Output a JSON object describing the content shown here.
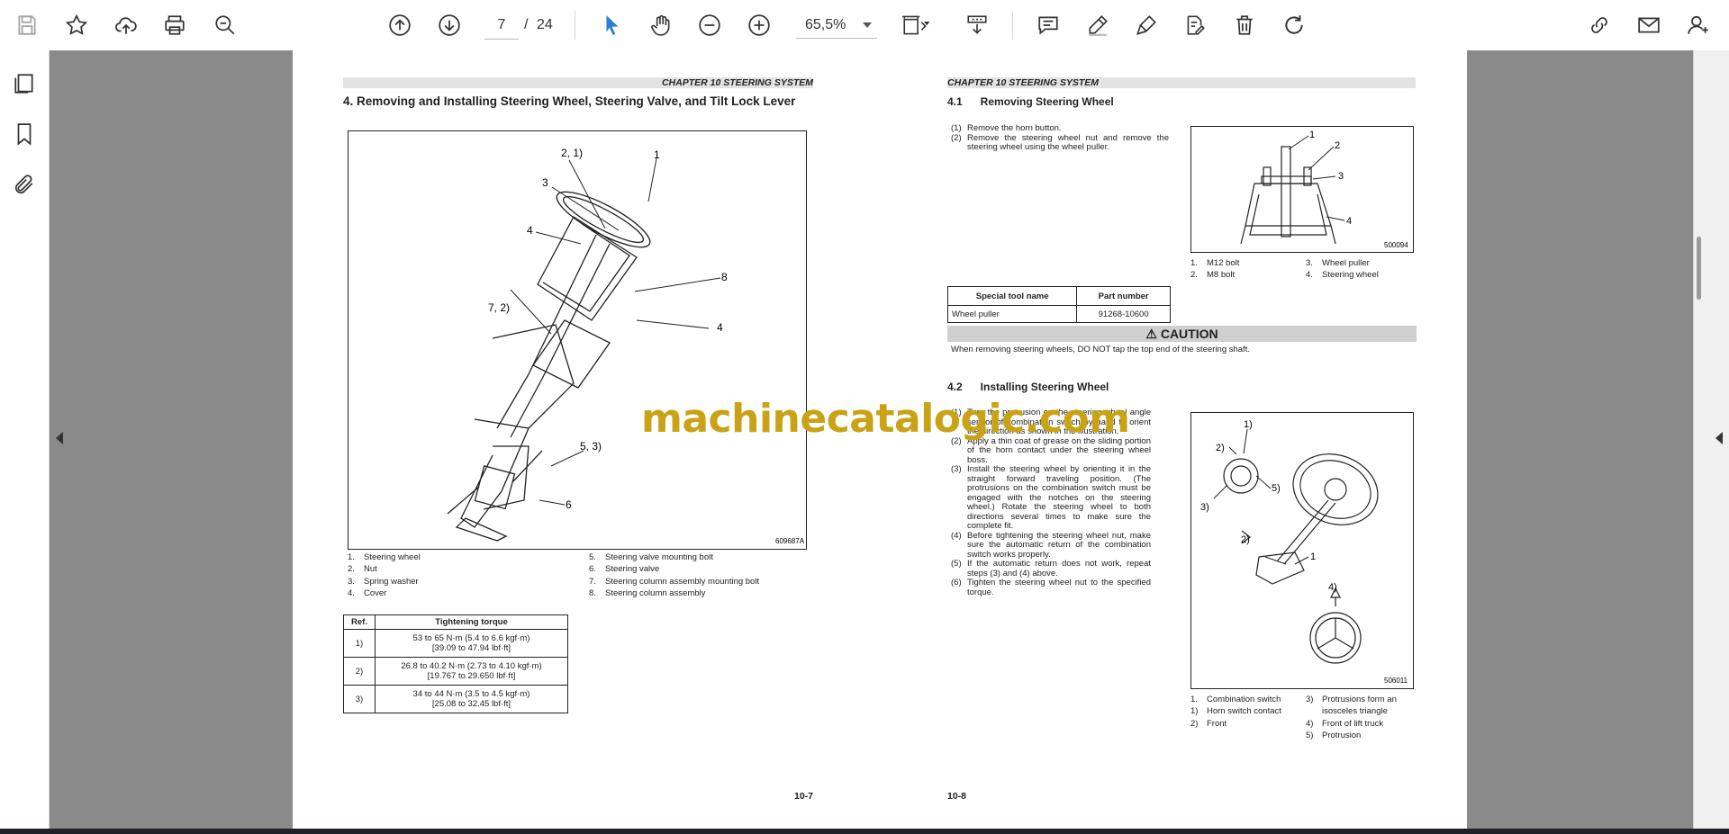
{
  "toolbar": {
    "page_current": "7",
    "page_sep": "/",
    "page_total": "24",
    "zoom": "65,5%"
  },
  "left_page": {
    "chapter": "CHAPTER 10 STEERING SYSTEM",
    "heading": "4.    Removing and Installing Steering Wheel, Steering Valve, and Tilt Lock Lever",
    "figure_code": "609687A",
    "callouts": [
      "2, 1)",
      "1",
      "3",
      "4",
      "8",
      "7, 2)",
      "4",
      "5, 3)",
      "6"
    ],
    "legend_left": [
      {
        "n": "1.",
        "t": "Steering wheel"
      },
      {
        "n": "2.",
        "t": "Nut"
      },
      {
        "n": "3.",
        "t": "Spring washer"
      },
      {
        "n": "4.",
        "t": "Cover"
      }
    ],
    "legend_right": [
      {
        "n": "5.",
        "t": "Steering valve mounting bolt"
      },
      {
        "n": "6.",
        "t": "Steering valve"
      },
      {
        "n": "7.",
        "t": "Steering column assembly mounting bolt"
      },
      {
        "n": "8.",
        "t": "Steering column assembly"
      }
    ],
    "torque_table": {
      "headers": [
        "Ref.",
        "Tightening torque"
      ],
      "rows": [
        {
          "ref": "1)",
          "l1": "53 to 65 N·m (5.4 to 6.6 kgf·m)",
          "l2": "[39.09 to 47.94 lbf·ft]"
        },
        {
          "ref": "2)",
          "l1": "26.8 to 40.2 N·m (2.73 to 4.10 kgf·m)",
          "l2": "[19.767 to 29.650 lbf·ft]"
        },
        {
          "ref": "3)",
          "l1": "34 to 44 N·m (3.5 to 4.5 kgf·m)",
          "l2": "[25.08 to 32.45 lbf·ft]"
        }
      ]
    },
    "page_number": "10-7"
  },
  "right_page": {
    "chapter": "CHAPTER 10 STEERING SYSTEM",
    "sec1_title": "4.1      Removing Steering Wheel",
    "sec1_steps": [
      {
        "n": "(1)",
        "t": "Remove the horn button."
      },
      {
        "n": "(2)",
        "t": "Remove the steering wheel nut and remove the steering wheel using the wheel puller."
      }
    ],
    "fig1_code": "500094",
    "fig1_callouts": [
      "1",
      "2",
      "3",
      "4"
    ],
    "fig1_legend_left": [
      {
        "n": "1.",
        "t": "M12 bolt"
      },
      {
        "n": "2.",
        "t": "M8 bolt"
      }
    ],
    "fig1_legend_right": [
      {
        "n": "3.",
        "t": "Wheel puller"
      },
      {
        "n": "4.",
        "t": "Steering wheel"
      }
    ],
    "tool_table": {
      "headers": [
        "Special tool name",
        "Part number"
      ],
      "rows": [
        {
          "name": "Wheel puller",
          "part": "91268-10600"
        }
      ]
    },
    "caution_title": "⚠ CAUTION",
    "caution_text": "When removing steering wheels, DO NOT tap the top end of the steering shaft.",
    "sec2_title": "4.2      Installing Steering Wheel",
    "sec2_steps": [
      {
        "n": "(1)",
        "t": "Turn the protrusion on the steering wheel angle sensor of combination switch by hand to orient the direction as shown in the illustration."
      },
      {
        "n": "(2)",
        "t": "Apply a thin coat of grease on the sliding portion of the horn contact under the steering wheel boss."
      },
      {
        "n": "(3)",
        "t": "Install the steering wheel by orienting it in the straight forward traveling position. (The protrusions on the combination switch must be engaged with the notches on the steering wheel.) Rotate the steering wheel to both directions several times to make sure the complete fit."
      },
      {
        "n": "(4)",
        "t": "Before tightening the steering wheel nut, make sure the automatic return of the combination switch works properly."
      },
      {
        "n": "(5)",
        "t": "If the automatic return does not work, repeat steps (3) and (4) above."
      },
      {
        "n": "(6)",
        "t": "Tighten the steering wheel nut to the specified torque."
      }
    ],
    "fig2_code": "506011",
    "fig2_callouts": [
      "1)",
      "2)",
      "5)",
      "3)",
      "2)",
      "1",
      "4)"
    ],
    "fig2_legend_left": [
      {
        "n": "1.",
        "t": "Combination switch"
      },
      {
        "n": "1)",
        "t": "Horn switch contact"
      },
      {
        "n": "2)",
        "t": "Front"
      }
    ],
    "fig2_legend_right": [
      {
        "n": "3)",
        "t": "Protrusions form an isosceles triangle"
      },
      {
        "n": "4)",
        "t": "Front of lift truck"
      },
      {
        "n": "5)",
        "t": "Protrusion"
      }
    ],
    "page_number": "10-8"
  },
  "watermark": "machinecatalogic.com",
  "colors": {
    "accent_blue": "#2a7fd4",
    "watermark": "#c9a315",
    "viewer_bg": "#8a8a8a"
  }
}
